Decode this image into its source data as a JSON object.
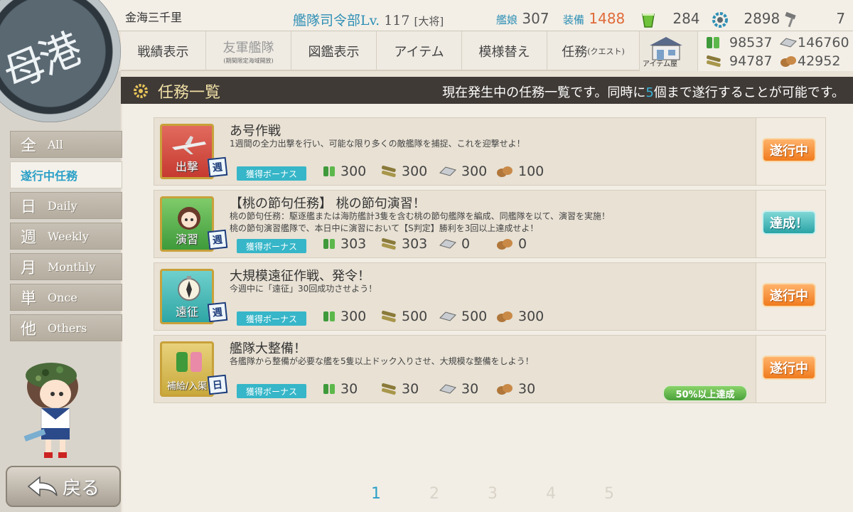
{
  "header": {
    "admiral_name": "金海三千里",
    "hq_label": "艦隊司令部",
    "level_label": "Lv.",
    "level": "117",
    "rank": "[大将]",
    "ships_label": "艦娘",
    "ships": "307",
    "equip_label": "装備",
    "equip": "1488",
    "buckets": "284",
    "dev_materials": "2898",
    "screws": "7"
  },
  "nav": [
    {
      "label": "戦績表示"
    },
    {
      "label": "友軍艦隊",
      "sub": "(期間限定海域開放)"
    },
    {
      "label": "図鑑表示"
    },
    {
      "label": "アイテム"
    },
    {
      "label": "模様替え"
    },
    {
      "label": "任務",
      "small": "(クエスト)"
    }
  ],
  "shop_label": "アイテム屋",
  "resources": {
    "fuel": "98537",
    "steel": "146760",
    "ammo": "94787",
    "bauxite": "42952"
  },
  "port_label": "母港",
  "sidebar": {
    "items": [
      {
        "kanji": "全",
        "label": "All"
      },
      {
        "kanji": "",
        "label": "遂行中任務"
      },
      {
        "kanji": "日",
        "label": "Daily"
      },
      {
        "kanji": "週",
        "label": "Weekly"
      },
      {
        "kanji": "月",
        "label": "Monthly"
      },
      {
        "kanji": "単",
        "label": "Once"
      },
      {
        "kanji": "他",
        "label": "Others"
      }
    ],
    "back_label": "戻る"
  },
  "title": {
    "text": "任務一覧",
    "note_pre": "現在発生中の任務一覧です。同時に",
    "note_num": "5",
    "note_post": "個まで遂行することが可能です。"
  },
  "quests": [
    {
      "category": "出撃",
      "freq": "週",
      "title": "あ号作戦",
      "desc1": "1週間の全力出撃を行い、可能な限り多くの敵艦隊を捕捉、これを迎撃せよ！",
      "desc2": "",
      "bonus": "獲得ボーナス",
      "fuel": "300",
      "ammo": "300",
      "steel": "300",
      "bauxite": "100",
      "status": "遂行中"
    },
    {
      "category": "演習",
      "freq": "週",
      "title": "【桃の節句任務】 桃の節句演習！",
      "desc1": "桃の節句任務：駆逐艦または海防艦計3隻を含む桃の節句艦隊を編成、同艦隊を以て、演習を実施！",
      "desc2": "桃の節句演習艦隊で、本日中に演習において【S判定】勝利を3回以上達成せよ！",
      "bonus": "獲得ボーナス",
      "fuel": "303",
      "ammo": "303",
      "steel": "0",
      "bauxite": "0",
      "status": "達成！"
    },
    {
      "category": "遠征",
      "freq": "週",
      "title": "大規模遠征作戦、発令！",
      "desc1": "今週中に「遠征」30回成功させよう！",
      "desc2": "",
      "bonus": "獲得ボーナス",
      "fuel": "300",
      "ammo": "500",
      "steel": "500",
      "bauxite": "300",
      "status": "遂行中"
    },
    {
      "category": "補給/入渠",
      "freq": "日",
      "title": "艦隊大整備！",
      "desc1": "各艦隊から整備が必要な艦を5隻以上ドック入りさせ、大規模な整備をしよう！",
      "desc2": "",
      "bonus": "獲得ボーナス",
      "fuel": "30",
      "ammo": "30",
      "steel": "30",
      "bauxite": "30",
      "status": "遂行中",
      "progress": "50%以上達成"
    }
  ],
  "pages": [
    "1",
    "2",
    "3",
    "4",
    "5"
  ],
  "colors": {
    "accent": "#2ba0c7",
    "in_progress": "#f07b1e",
    "completed": "#2aa3a6",
    "bonus": "#36b6c8"
  }
}
